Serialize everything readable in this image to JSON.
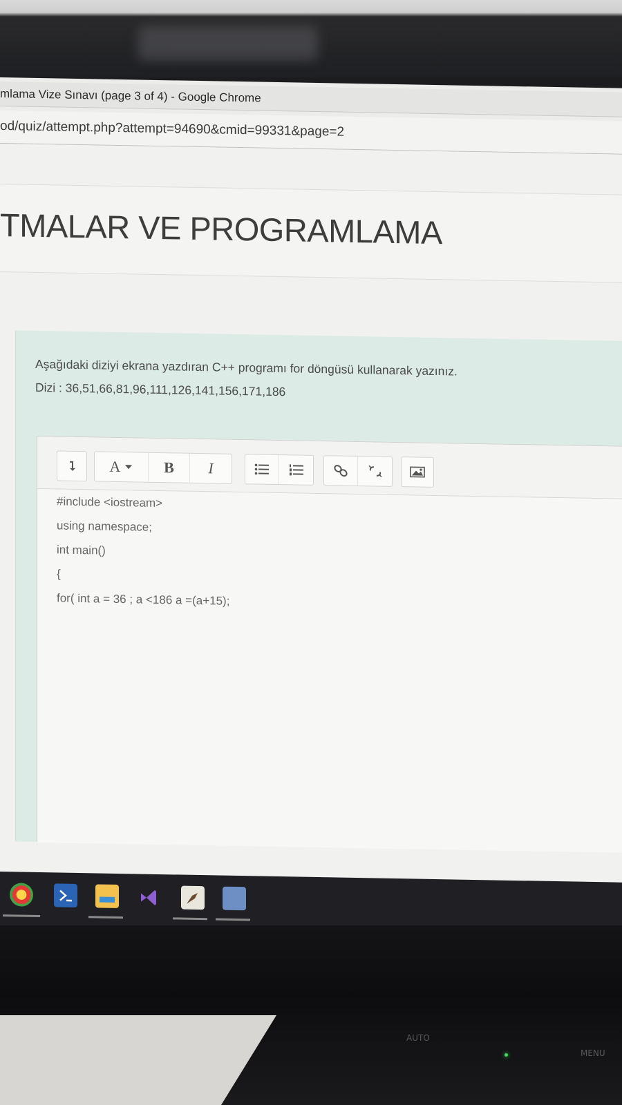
{
  "window": {
    "title": "mlama Vize Sınavı (page 3 of 4) - Google Chrome"
  },
  "address_bar": {
    "url": "od/quiz/attempt.php?attempt=94690&cmid=99331&page=2"
  },
  "course": {
    "title": "TMALAR VE PROGRAMLAMA"
  },
  "question": {
    "text": "Aşağıdaki diziyi ekrana yazdıran C++ programı for döngüsü kullanarak yazınız.",
    "sequence": "Dizi : 36,51,66,81,96,111,126,141,156,171,186"
  },
  "editor": {
    "toolbar": {
      "toggle_icon": "expand-toolbar-icon",
      "font_label": "A",
      "bold_label": "B",
      "italic_label": "I",
      "unordered_list_icon": "unordered-list-icon",
      "ordered_list_icon": "ordered-list-icon",
      "link_icon": "link-icon",
      "unlink_icon": "unlink-icon",
      "image_icon": "image-icon"
    },
    "content": [
      "#include <iostream>",
      "using namespace;",
      "int main()",
      "{",
      " for( int a = 36 ; a <186 a =(a+15);"
    ]
  },
  "taskbar": {
    "apps": [
      "chrome-icon",
      "powershell-icon",
      "file-explorer-icon",
      "visual-studio-icon",
      "paint-icon",
      "app-window-icon"
    ]
  },
  "monitor": {
    "label_auto": "AUTO",
    "label_menu": "MENU"
  },
  "colors": {
    "question_bg": "#dcebe6",
    "editor_bg": "#f7f7f6",
    "text": "#4c4c4c"
  }
}
